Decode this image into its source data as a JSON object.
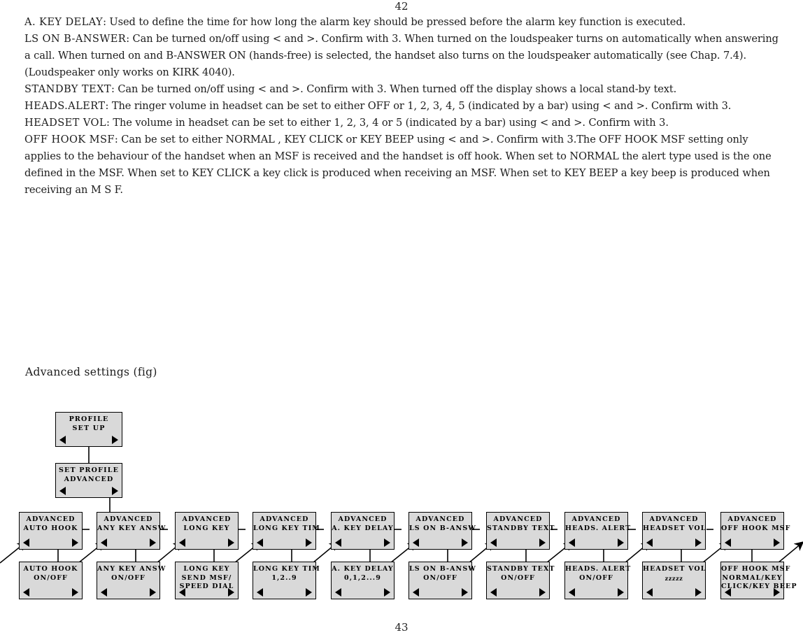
{
  "page": {
    "number_top": "42",
    "number_bottom": "43"
  },
  "body": {
    "paragraphs": [
      {
        "term": "A. KEY DELAY",
        "text": ": Used to define the time for how long the alarm key should be pressed before the alarm key function is executed."
      },
      {
        "term": "LS ON B-ANSWER",
        "text": ": Can be turned on/off using < and >. Confirm with 3. When turned on the loudspeaker turns on automatically when answering a call. When turned on and  B-ANSWER ON  (hands-free) is selected, the handset also turns on the loudspeaker automatically (see Chap. 7.4). (Loudspeaker only works on KIRK 4040)."
      },
      {
        "term": "STANDBY TEXT",
        "text": ": Can be turned on/off using < and >. Confirm with 3. When turned off the display shows a local stand-by text."
      },
      {
        "term": "HEADS.ALERT",
        "text": ": The ringer volume in headset can be set to either  OFF  or 1, 2, 3, 4, 5 (indicated by a bar) using < and >. Confirm with 3."
      },
      {
        "term": "HEADSET VOL",
        "text": ": The volume in headset can be set to either 1, 2, 3, 4 or 5 (indicated by a bar) using < and >. Confirm with 3."
      },
      {
        "term": "OFF HOOK MSF",
        "text": ": Can be set to either  NORMAL ,  KEY CLICK  or  KEY BEEP  using < and >. Confirm with 3.The  OFF HOOK MSF  setting only applies to the behaviour of the handset when an MSF is received and the handset is off hook. When set to  NORMAL  the alert type used is the one defined in the MSF. When set to  KEY CLICK  a key click is produced when receiving an MSF. When set to  KEY BEEP  a key beep is produced when receiving an M S F."
      }
    ]
  },
  "figure": {
    "caption": "Advanced settings (fig)",
    "root": {
      "id": "profile-setup",
      "lines": [
        "PROFILE",
        "SET UP"
      ],
      "left_arrow": "left-arrow-icon",
      "right_arrow": "right-arrow-icon"
    },
    "second": {
      "id": "set-profile-advanced",
      "lines": [
        "SET PROFILE",
        "ADVANCED"
      ],
      "left_arrow": "left-arrow-icon",
      "right_arrow": "right-arrow-icon"
    },
    "columns": [
      {
        "menu": {
          "lines": [
            "ADVANCED",
            "AUTO HOOK"
          ]
        },
        "value": {
          "lines": [
            "AUTO HOOK",
            "ON/OFF"
          ]
        }
      },
      {
        "menu": {
          "lines": [
            "ADVANCED",
            "ANY KEY ANSW"
          ]
        },
        "value": {
          "lines": [
            "ANY KEY ANSW",
            "ON/OFF"
          ]
        }
      },
      {
        "menu": {
          "lines": [
            "ADVANCED",
            "LONG KEY"
          ]
        },
        "value": {
          "lines": [
            "LONG KEY",
            "SEND MSF/",
            "SPEED DIAL"
          ]
        }
      },
      {
        "menu": {
          "lines": [
            "ADVANCED",
            "LONG KEY TIM"
          ]
        },
        "value": {
          "lines": [
            "LONG KEY TIM",
            "1,2..9"
          ]
        }
      },
      {
        "menu": {
          "lines": [
            "ADVANCED",
            "A. KEY DELAY"
          ]
        },
        "value": {
          "lines": [
            "A. KEY DELAY",
            "0,1,2...9"
          ]
        }
      },
      {
        "menu": {
          "lines": [
            "ADVANCED",
            "LS ON B-ANSW"
          ]
        },
        "value": {
          "lines": [
            "LS ON B-ANSW",
            "ON/OFF"
          ]
        }
      },
      {
        "menu": {
          "lines": [
            "ADVANCED",
            "STANDBY TEXT"
          ]
        },
        "value": {
          "lines": [
            "STANDBY TEXT",
            "ON/OFF"
          ]
        }
      },
      {
        "menu": {
          "lines": [
            "ADVANCED",
            "HEADS. ALERT"
          ]
        },
        "value": {
          "lines": [
            "HEADS. ALERT",
            "ON/OFF"
          ]
        }
      },
      {
        "menu": {
          "lines": [
            "ADVANCED",
            "HEADSET VOL"
          ]
        },
        "value": {
          "lines": [
            "HEADSET VOL",
            "zzzzz"
          ]
        }
      },
      {
        "menu": {
          "lines": [
            "ADVANCED",
            "OFF HOOK MSF"
          ]
        },
        "value": {
          "lines": [
            "OFF HOOK MSF",
            "NORMAL/KEY",
            "CLICK/KEY BEEP"
          ]
        }
      }
    ]
  },
  "colors": {
    "node_fill": "#d9d9d9",
    "node_border": "#000000",
    "text": "#1a1a1a",
    "page_bg": "#ffffff"
  }
}
